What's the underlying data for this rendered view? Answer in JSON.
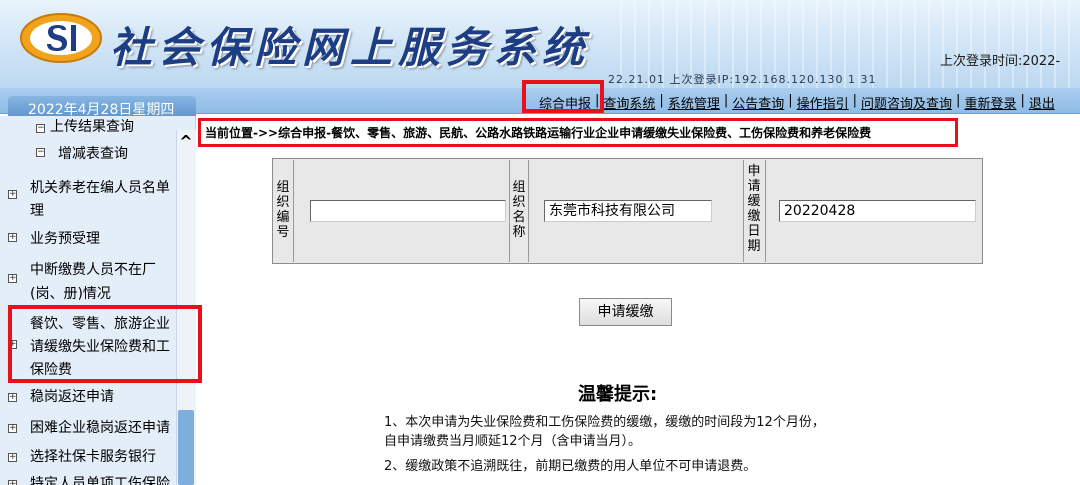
{
  "header": {
    "title": "社会保险网上服务系统",
    "last_login": "上次登录时间:2022-",
    "login_info": "22.21.01  上次登录IP:192.168.120.130  1  31"
  },
  "date_text": "2022年4月28日星期四",
  "nav": {
    "items": [
      "综合申报",
      "查询系统",
      "系统管理",
      "公告查询",
      "操作指引",
      "问题咨询及查询",
      "重新登录",
      "退出"
    ]
  },
  "breadcrumb": "当前位置->>综合申报-餐饮、零售、旅游、民航、公路水路铁路运输行业企业申请缓缴失业保险费、工伤保险费和养老保险费",
  "sidebar": {
    "items": [
      {
        "label": "上传结果查询"
      },
      {
        "label": "增减表查询"
      },
      {
        "label_lines": [
          "机关养老在编人员名单",
          "理"
        ]
      },
      {
        "label": "业务预受理"
      },
      {
        "label_lines": [
          "中断缴费人员不在厂",
          "(岗、册)情况"
        ]
      },
      {
        "label_lines": [
          "餐饮、零售、旅游企业",
          "请缓缴失业保险费和工",
          "保险费"
        ]
      },
      {
        "label": "稳岗返还申请"
      },
      {
        "label": "困难企业稳岗返还申请"
      },
      {
        "label": "选择社保卡服务银行"
      },
      {
        "label": "特定人员单项工伤保险"
      }
    ]
  },
  "form": {
    "org_code_label": "组织编号",
    "org_code_value": "",
    "org_name_label": "组织名称",
    "org_name_value": "东莞市科技有限公司",
    "apply_date_label": "申请缓缴日期",
    "apply_date_value": "20220428"
  },
  "apply_button": "申请缓缴",
  "notice": {
    "title": "温馨提示:",
    "lines": [
      "1、本次申请为失业保险费和工伤保险费的缓缴，缓缴的时间段为12个月份，",
      "自申请缴费当月顺延12个月（含申请当月）。",
      "2、缓缴政策不追溯既往，前期已缴费的用人单位不可申请退费。"
    ]
  },
  "colors": {
    "highlight": "#e8101c",
    "title_blue": "#1d3e84",
    "nav_blue": "#8fbce6"
  }
}
